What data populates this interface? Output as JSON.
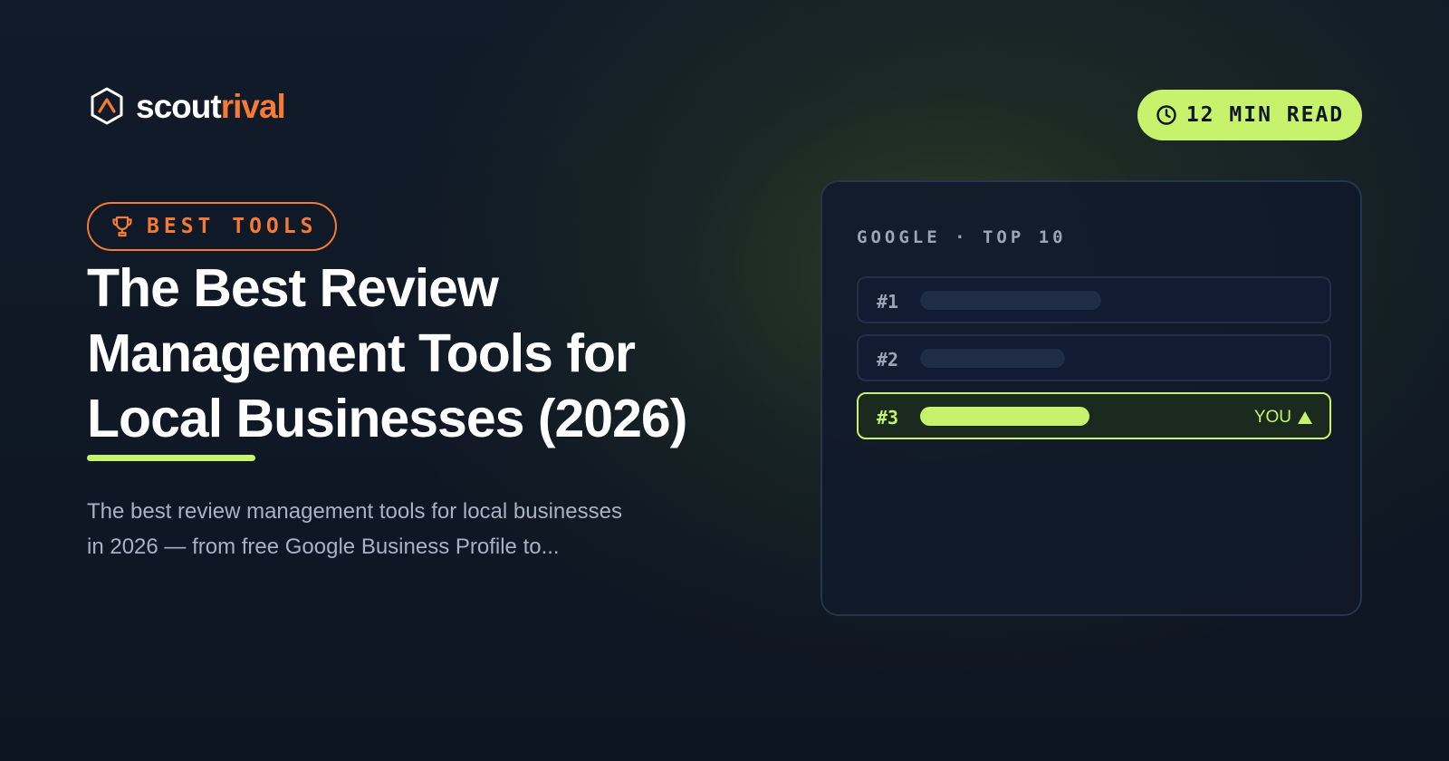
{
  "brand": {
    "name_part1": "scout",
    "name_part2": "rival",
    "accent_color": "#f47a36",
    "highlight_color": "#c6f36b",
    "icon": "scoutrival-hexagon-logo-icon"
  },
  "read_time": {
    "icon": "clock-icon",
    "label": "12 MIN READ"
  },
  "category": {
    "icon": "trophy-icon",
    "label": "BEST TOOLS"
  },
  "title_lines": [
    "The Best Review",
    "Management Tools for",
    "Local Businesses (2026)"
  ],
  "description_lines": [
    "The best review management tools for local businesses",
    "in 2026 — from free Google Business Profile to..."
  ],
  "ranking_card": {
    "header": "GOOGLE · TOP 10",
    "rows": [
      {
        "rank": "#1",
        "highlighted": false
      },
      {
        "rank": "#2",
        "highlighted": false
      },
      {
        "rank": "#3",
        "highlighted": true,
        "tag": "YOU",
        "tag_icon": "triangle-up-icon"
      }
    ]
  }
}
